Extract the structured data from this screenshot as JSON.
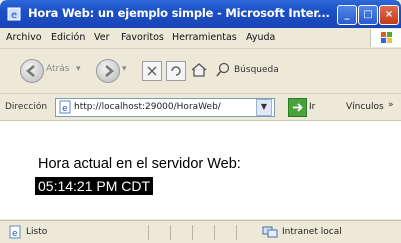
{
  "window": {
    "title": "Hora Web: un ejemplo simple - Microsoft Inter..."
  },
  "menu": {
    "items": [
      "Archivo",
      "Edición",
      "Ver",
      "Favoritos",
      "Herramientas",
      "Ayuda"
    ]
  },
  "toolbar": {
    "back_label": "Atrás",
    "search_label": "Búsqueda"
  },
  "address": {
    "label": "Dirección",
    "url": "http://localhost:29000/HoraWeb/",
    "go_label": "Ir",
    "links_label": "Vínculos"
  },
  "content": {
    "heading": "Hora actual en el servidor Web:",
    "time": "05:14:21 PM CDT"
  },
  "status": {
    "text": "Listo",
    "zone": "Intranet local"
  },
  "colors": {
    "titlebar": "#1c4fc7",
    "chrome": "#ece9d8",
    "time_background": "#000000"
  }
}
